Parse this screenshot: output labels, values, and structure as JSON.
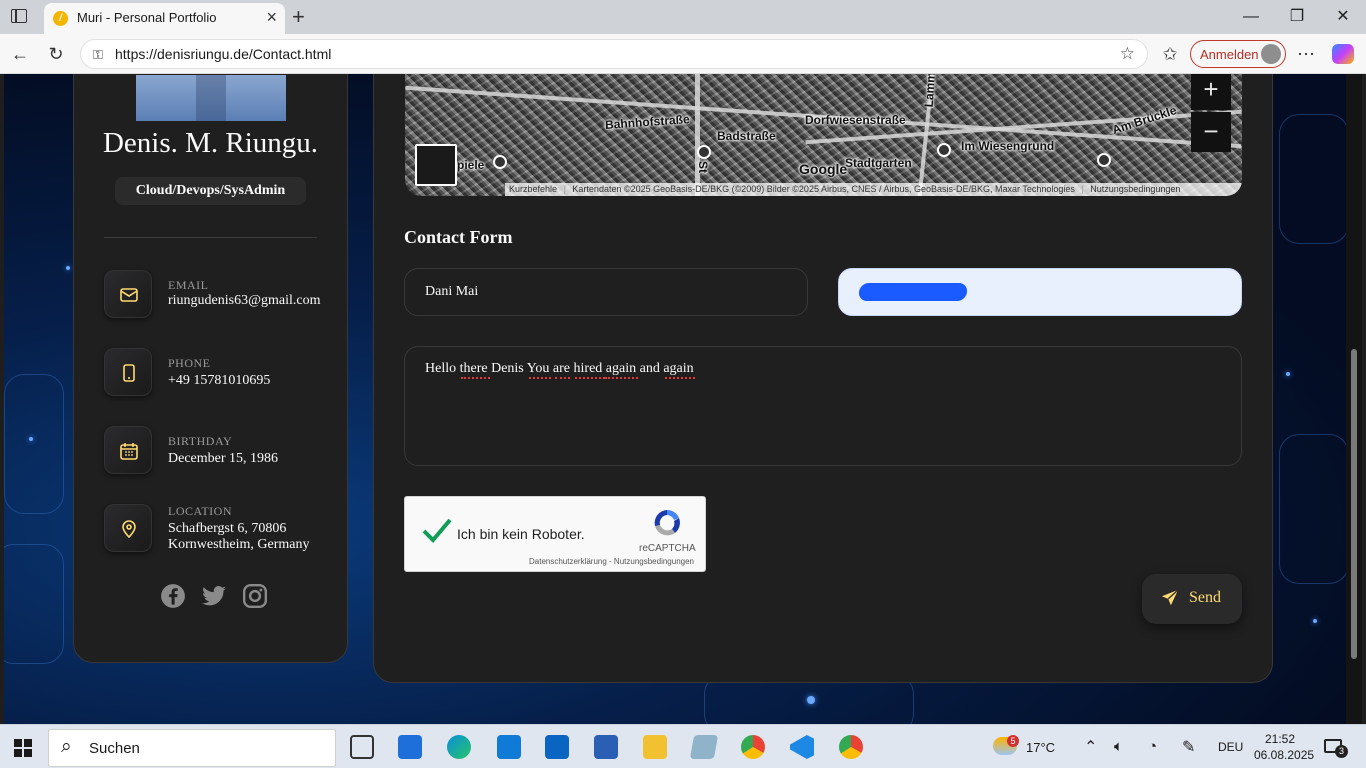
{
  "browser": {
    "tab_title": "Muri - Personal Portfolio",
    "url": "https://denisriungu.de/Contact.html",
    "signin_label": "Anmelden"
  },
  "profile": {
    "name": "Denis. M. Riungu.",
    "role": "Cloud/Devops/SysAdmin",
    "contacts": [
      {
        "label": "EMAIL",
        "value": "riungudenis63@gmail.com",
        "icon": "mail-icon"
      },
      {
        "label": "PHONE",
        "value": "+49 15781010695",
        "icon": "phone-icon"
      },
      {
        "label": "BIRTHDAY",
        "value": "December 15, 1986",
        "icon": "calendar-icon"
      },
      {
        "label": "LOCATION",
        "value": "Schafbergst 6, 70806",
        "value2": "Kornwestheim, Germany",
        "icon": "location-pin-icon"
      }
    ],
    "social": [
      "facebook-icon",
      "twitter-icon",
      "instagram-icon"
    ]
  },
  "map": {
    "labels": [
      "Bahnhofstraße",
      "Badstraße",
      "Dorfwiesenstraße",
      "Im Wiesengrund",
      "Am Brückle",
      "Stadtgarten",
      "Lammstr",
      "piele",
      "St"
    ],
    "logo": "Google",
    "shortcuts": "Kurzbefehle",
    "attribution": "Kartendaten ©2025 GeoBasis-DE/BKG (©2009) Bilder ©2025 Airbus, CNES / Airbus, GeoBasis-DE/BKG, Maxar Technologies",
    "terms": "Nutzungsbedingungen",
    "zoom_in": "+",
    "zoom_out": "−"
  },
  "contact_form": {
    "title": "Contact Form",
    "name_value": "Dani Mai",
    "message_value": "Hello there Denis You are hired again and again",
    "captcha_label": "Ich bin kein Roboter.",
    "captcha_brand": "reCAPTCHA",
    "captcha_terms": "Datenschutzerklärung - Nutzungsbedingungen",
    "send_label": "Send"
  },
  "taskbar": {
    "search_label": "Suchen",
    "weather": "17°C",
    "weather_badge": "5",
    "language": "DEU",
    "time": "21:52",
    "date": "06.08.2025",
    "notifications": "3"
  },
  "colors": {
    "accent": "#ffdb70",
    "card_bg": "#1f1f20",
    "page_bg": "#061f4a"
  }
}
